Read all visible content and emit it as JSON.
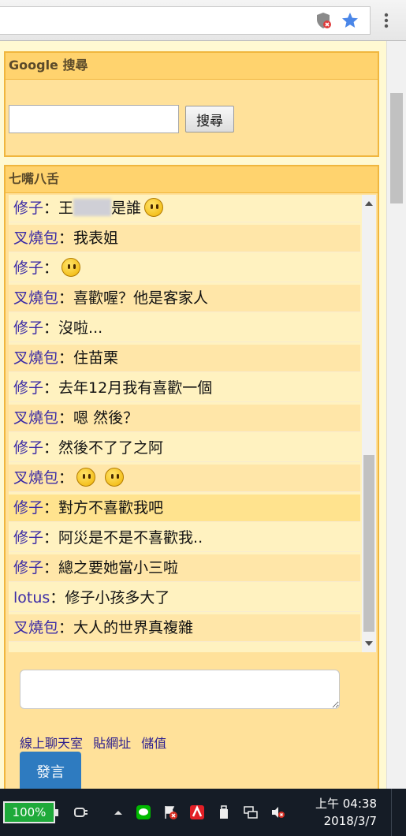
{
  "browser": {
    "icons": [
      "shield-icon",
      "star-icon",
      "more-vert-icon"
    ]
  },
  "google": {
    "title": "Google 搜尋",
    "search_placeholder": "",
    "search_button": "搜尋"
  },
  "chat": {
    "title": "七嘴八舌",
    "colon": "：",
    "messages": [
      {
        "name": "修子",
        "text": "王",
        "text2": "是誰",
        "blurred": true,
        "emoji": "smirk"
      },
      {
        "name": "叉燒包",
        "text": "我表姐"
      },
      {
        "name": "修子",
        "text": "",
        "emoji": "laugh"
      },
      {
        "name": "叉燒包",
        "text": "喜歡喔？他是客家人"
      },
      {
        "name": "修子",
        "text": "沒啦..."
      },
      {
        "name": "叉燒包",
        "text": "住苗栗"
      },
      {
        "name": "修子",
        "text": "去年12月我有喜歡一個"
      },
      {
        "name": "叉燒包",
        "text": "嗯 然後？"
      },
      {
        "name": "修子",
        "text": "然後不了了之阿"
      },
      {
        "name": "叉燒包",
        "text": "",
        "emoji": "smile-smile"
      },
      {
        "name": "修子",
        "text": "對方不喜歡我吧"
      },
      {
        "name": "修子",
        "text": "阿災是不是不喜歡我.."
      },
      {
        "name": "修子",
        "text": "總之要她當小三啦"
      },
      {
        "name": "lotus",
        "text": "修子小孩多大了"
      },
      {
        "name": "叉燒包",
        "text": "大人的世界真複雜"
      }
    ],
    "input_placeholder": "",
    "links": [
      "線上聊天室",
      "貼網址",
      "儲值"
    ],
    "send_button": "發言"
  },
  "taskbar": {
    "battery": "100%",
    "time": "上午 04:38",
    "date": "2018/3/7",
    "tray_icons": [
      "plug-icon",
      "chevron-up-icon",
      "line-app-icon",
      "flag-error-icon",
      "antivirus-icon",
      "usb-icon",
      "network-icon",
      "volume-mute-icon"
    ]
  }
}
